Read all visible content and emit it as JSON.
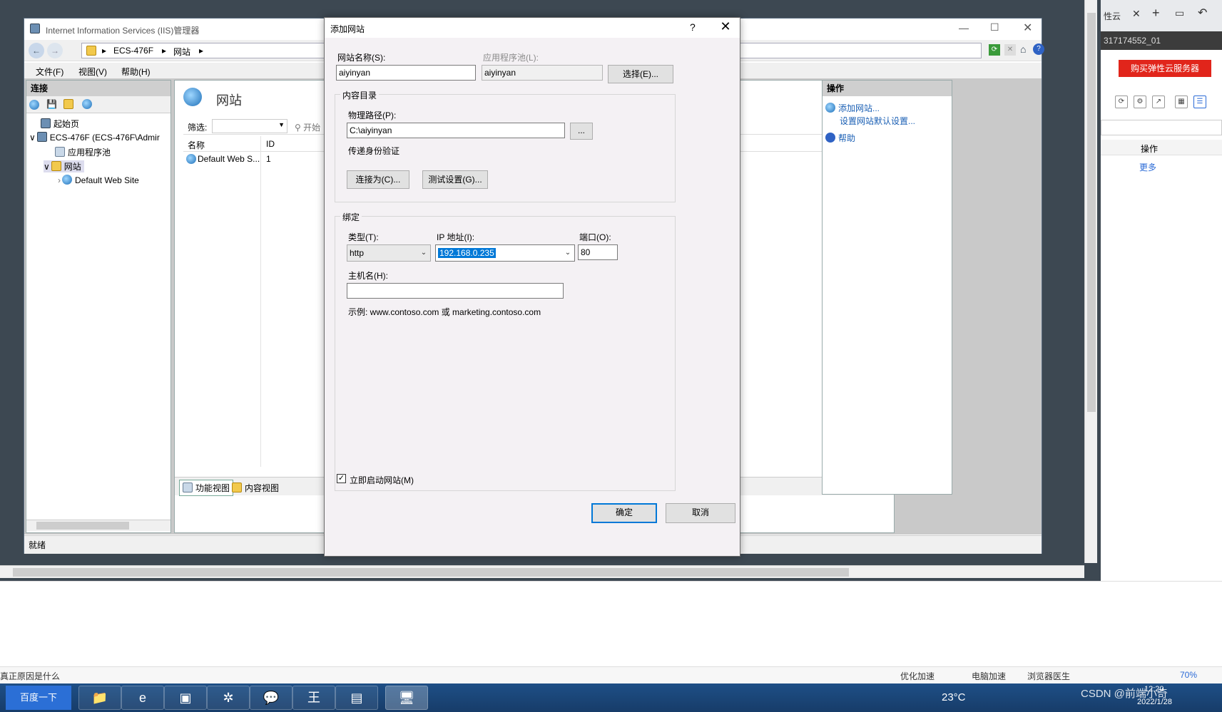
{
  "iis": {
    "title": "Internet Information Services (IIS)管理器",
    "breadcrumb": [
      "ECS-476F",
      "网站"
    ],
    "menu": [
      "文件(F)",
      "视图(V)",
      "帮助(H)"
    ],
    "connections": {
      "header": "连接",
      "tree": [
        "起始页",
        "ECS-476F (ECS-476F\\Admir",
        "应用程序池",
        "网站",
        "Default Web Site"
      ]
    },
    "center": {
      "title": "网站",
      "filter_label": "筛选:",
      "filter_btn": "开始",
      "columns": [
        "名称",
        "ID"
      ],
      "rows": [
        {
          "name": "Default Web S...",
          "id": "1"
        }
      ],
      "view_feature": "功能视图",
      "view_content": "内容视图"
    },
    "actions": {
      "header": "操作",
      "add_site": "添加网站...",
      "set_defaults": "设置网站默认设置...",
      "help": "帮助"
    },
    "status": "就绪"
  },
  "dialog": {
    "title": "添加网站",
    "help": "?",
    "close": "✕",
    "site_name_label": "网站名称(S):",
    "site_name_value": "aiyinyan",
    "app_pool_label": "应用程序池(L):",
    "app_pool_value": "aiyinyan",
    "select_btn": "选择(E)...",
    "content_dir": "内容目录",
    "physical_path_label": "物理路径(P):",
    "physical_path_value": "C:\\aiyinyan",
    "browse_btn": "...",
    "pass_auth": "传递身份验证",
    "connect_as_btn": "连接为(C)...",
    "test_settings_btn": "测试设置(G)...",
    "binding": "绑定",
    "type_label": "类型(T):",
    "type_value": "http",
    "ip_label": "IP 地址(I):",
    "ip_value": "192.168.0.235",
    "port_label": "端口(O):",
    "port_value": "80",
    "host_label": "主机名(H):",
    "host_value": "",
    "example": "示例: www.contoso.com 或 marketing.contoso.com",
    "start_now": "立即启动网站(M)",
    "ok": "确定",
    "cancel": "取消"
  },
  "browser": {
    "tab_text": "性云",
    "addr_text": "317174552_01",
    "buy_btn": "购买弹性云服务器",
    "col_ops": "操作",
    "more": "更多",
    "bottom_left": "真正原因是什么",
    "status_items": [
      "优化加速",
      "电脑加速",
      "浏览器医生"
    ],
    "zoom": "70%"
  },
  "taskbar": {
    "search_btn": "百度一下",
    "weather": "23°C",
    "time": "12:20",
    "date": "2022/1/28",
    "watermark": "CSDN @前端小奇"
  }
}
